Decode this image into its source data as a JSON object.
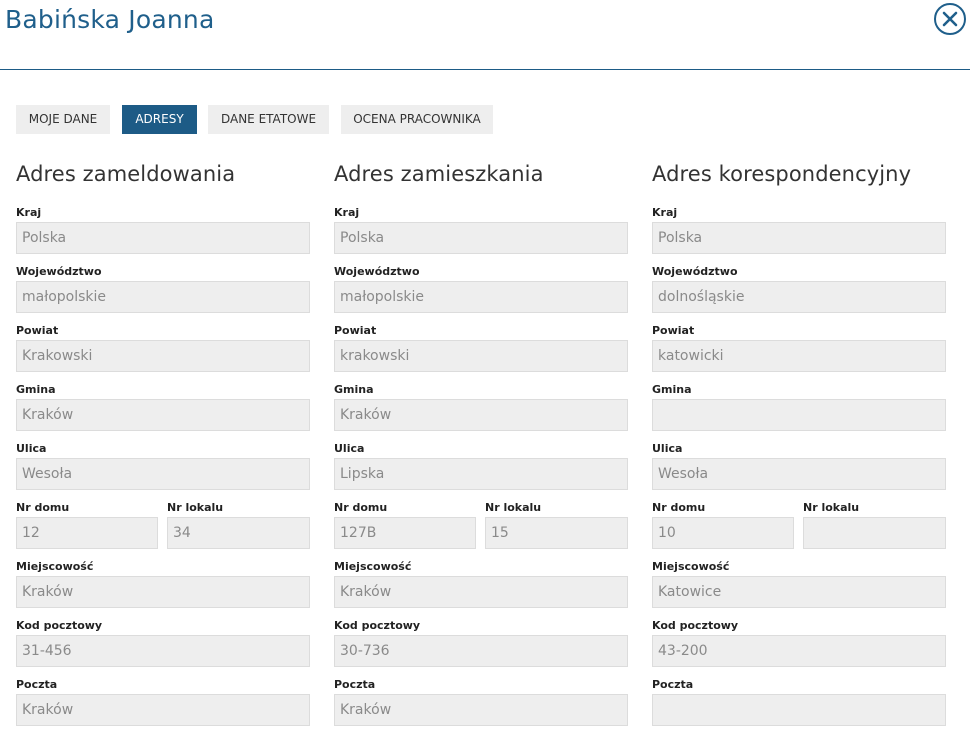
{
  "header": {
    "title": "Babińska Joanna"
  },
  "tabs": [
    "MOJE DANE",
    "ADRESY",
    "DANE ETATOWE",
    "OCENA PRACOWNIKA"
  ],
  "active_tab": "ADRESY",
  "labels": {
    "kraj": "Kraj",
    "wojewodztwo": "Województwo",
    "powiat": "Powiat",
    "gmina": "Gmina",
    "ulica": "Ulica",
    "nr_domu": "Nr domu",
    "nr_lokalu": "Nr lokalu",
    "miejscowosc": "Miejscowość",
    "kod": "Kod pocztowy",
    "poczta": "Poczta"
  },
  "columns": [
    {
      "heading": "Adres zameldowania",
      "kraj": "Polska",
      "wojewodztwo": "małopolskie",
      "powiat": "Krakowski",
      "gmina": "Kraków",
      "ulica": "Wesoła",
      "nr_domu": "12",
      "nr_lokalu": "34",
      "miejscowosc": "Kraków",
      "kod": "31-456",
      "poczta": "Kraków"
    },
    {
      "heading": "Adres zamieszkania",
      "kraj": "Polska",
      "wojewodztwo": "małopolskie",
      "powiat": "krakowski",
      "gmina": "Kraków",
      "ulica": "Lipska",
      "nr_domu": "127B",
      "nr_lokalu": "15",
      "miejscowosc": "Kraków",
      "kod": "30-736",
      "poczta": "Kraków"
    },
    {
      "heading": "Adres korespondencyjny",
      "kraj": "Polska",
      "wojewodztwo": "dolnośląskie",
      "powiat": "katowicki",
      "gmina": "",
      "ulica": "Wesoła",
      "nr_domu": "10",
      "nr_lokalu": "",
      "miejscowosc": "Katowice",
      "kod": "43-200",
      "poczta": ""
    }
  ]
}
